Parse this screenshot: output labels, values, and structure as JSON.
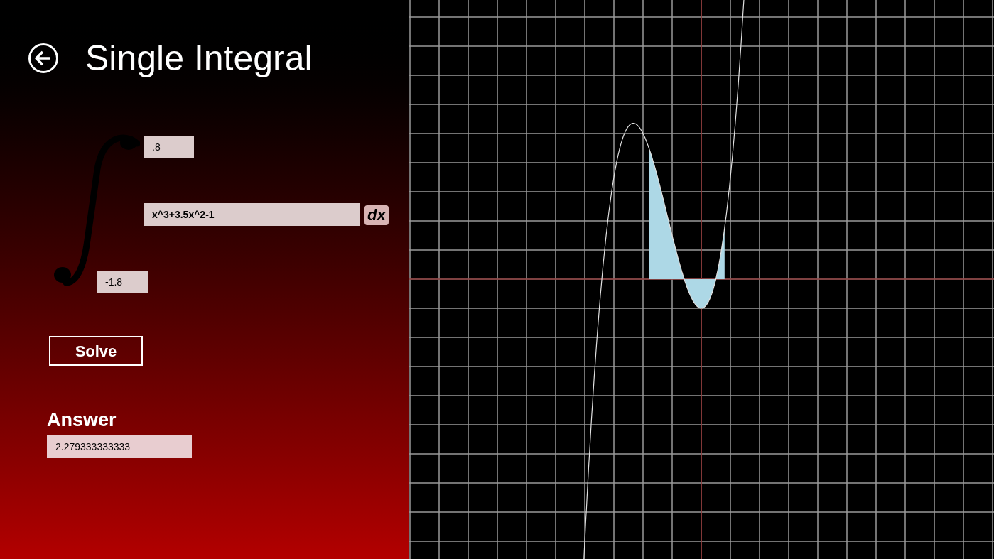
{
  "header": {
    "title": "Single Integral"
  },
  "integral": {
    "upper_limit": ".8",
    "integrand": "x^3+3.5x^2-1",
    "differential": "dx",
    "lower_limit": "-1.8"
  },
  "solve_button": "Solve",
  "answer": {
    "label": "Answer",
    "value": "2.279333333333"
  }
}
